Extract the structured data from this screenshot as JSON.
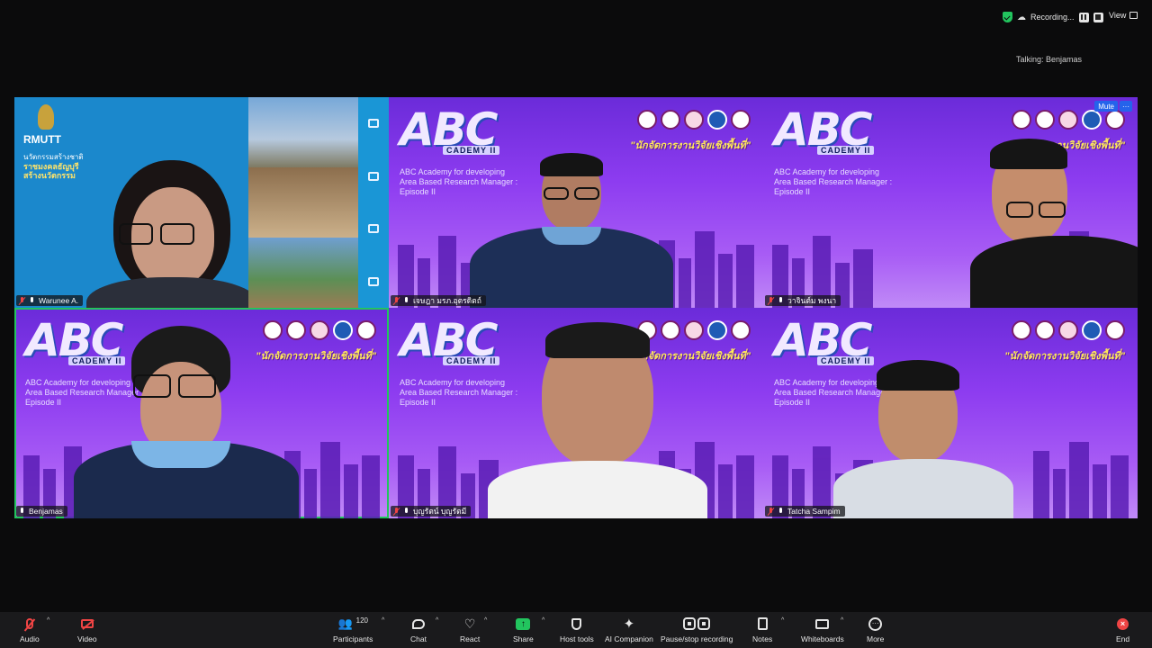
{
  "topbar": {
    "recording_label": "Recording...",
    "view_label": "View",
    "talking_label": "Talking: Benjamas"
  },
  "tile_content": {
    "logo_text": "ABC",
    "logo_sub": "CADEMY II",
    "desc_lines": [
      "ABC Academy for developing",
      "Area Based Research Manager :",
      "Episode II"
    ],
    "thai_title": "\"นักจัดการงานวิจัยเชิงพื้นที่\"",
    "uni_lines": [
      "นวัตกรรมสร้างชาติ",
      "ราชมงคลธัญบุรี",
      "สร้างนวัตกรรม"
    ],
    "uni_mark": "RMUTT"
  },
  "tile_controls": {
    "mute_label": "Mute",
    "more_label": "···"
  },
  "participants": [
    {
      "name": "Warunee A."
    },
    {
      "name": "เจษฎา มรภ.อุตรดิตถ์"
    },
    {
      "name": "วาจินต์ม พงนา"
    },
    {
      "name": "Benjamas"
    },
    {
      "name": "บุญรัตน์ บุญรัตมี"
    },
    {
      "name": "Tatcha Sampim"
    }
  ],
  "toolbar": {
    "audio": "Audio",
    "video": "Video",
    "participants": "Participants",
    "participant_count": "120",
    "chat": "Chat",
    "react": "React",
    "share": "Share",
    "host_tools": "Host tools",
    "ai_companion": "AI Companion",
    "pause_recording": "Pause/stop recording",
    "notes": "Notes",
    "whiteboards": "Whiteboards",
    "more": "More",
    "end": "End"
  },
  "colors": {
    "active_speaker": "#22c55e",
    "background": "#0b0b0c",
    "tile_purple": "#8d3cf0",
    "muted_red": "#ef4444",
    "mute_button_blue": "#2563eb"
  }
}
